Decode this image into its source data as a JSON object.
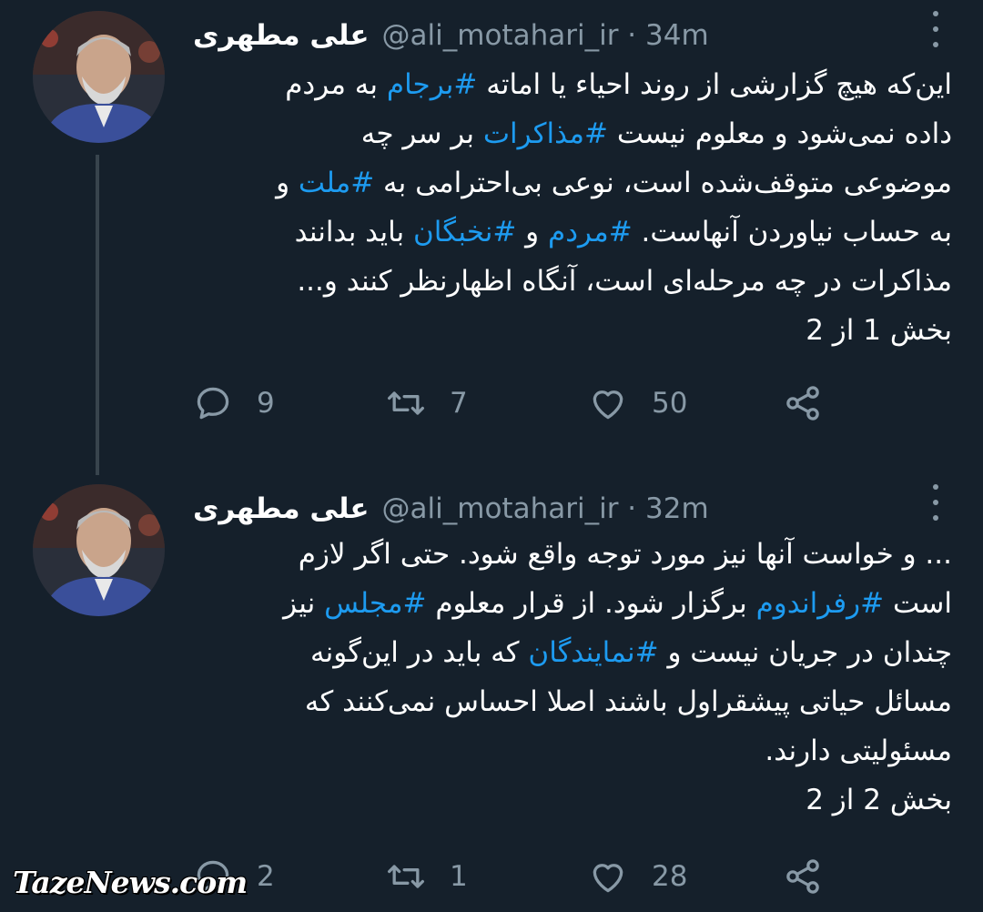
{
  "tweets": [
    {
      "author_name": "علی مطهری",
      "handle_time": "@ali_motahari_ir · 34m",
      "lines": [
        [
          {
            "t": "این‌که هیچ گزارشی از روند احیاء یا اماته ",
            "h": false
          },
          {
            "t": "#برجام",
            "h": true
          },
          {
            "t": " به مردم",
            "h": false
          }
        ],
        [
          {
            "t": "داده نمی‌شود و معلوم نیست ",
            "h": false
          },
          {
            "t": "#مذاکرات",
            "h": true
          },
          {
            "t": " بر سر چه",
            "h": false
          }
        ],
        [
          {
            "t": "موضوعی متوقف‌شده است، نوعی بی‌احترامی به ",
            "h": false
          },
          {
            "t": "#ملت",
            "h": true
          },
          {
            "t": " و",
            "h": false
          }
        ],
        [
          {
            "t": "به حساب نیاوردن آنهاست. ",
            "h": false
          },
          {
            "t": "#مردم",
            "h": true
          },
          {
            "t": " و ",
            "h": false
          },
          {
            "t": "#نخبگان",
            "h": true
          },
          {
            "t": " باید بدانند",
            "h": false
          }
        ],
        [
          {
            "t": "مذاکرات در چه مرحله‌ای است، آنگاه اظهارنظر کنند و...",
            "h": false
          }
        ],
        [
          {
            "t": "بخش 1 از 2",
            "h": false
          }
        ]
      ],
      "replies": "9",
      "retweets": "7",
      "likes": "50"
    },
    {
      "author_name": "علی مطهری",
      "handle_time": "@ali_motahari_ir · 32m",
      "lines": [
        [
          {
            "t": "... و خواست آنها نیز مورد توجه واقع شود. حتی اگر لازم",
            "h": false
          }
        ],
        [
          {
            "t": "است ",
            "h": false
          },
          {
            "t": "#رفراندوم",
            "h": true
          },
          {
            "t": " برگزار شود. از قرار معلوم ",
            "h": false
          },
          {
            "t": "#مجلس",
            "h": true
          },
          {
            "t": " نیز",
            "h": false
          }
        ],
        [
          {
            "t": "چندان در جریان نیست و ",
            "h": false
          },
          {
            "t": "#نمایندگان",
            "h": true
          },
          {
            "t": " که باید در این‌گونه",
            "h": false
          }
        ],
        [
          {
            "t": "مسائل حیاتی پیشقراول باشند اصلا احساس نمی‌کنند که",
            "h": false
          }
        ],
        [
          {
            "t": "مسئولیتی دارند.",
            "h": false
          }
        ],
        [
          {
            "t": "بخش 2 از 2",
            "h": false
          }
        ]
      ],
      "replies": "2",
      "retweets": "1",
      "likes": "28"
    }
  ],
  "icons": {
    "reply": "reply-icon",
    "retweet": "retweet-icon",
    "like": "heart-icon",
    "share": "share-icon",
    "more": "more-icon"
  },
  "colors": {
    "background": "#15202b",
    "hashtag": "#1d9bf0",
    "secondary_text": "#8899a6",
    "thread_line": "#38444d"
  },
  "watermark": "TazeNews.com"
}
